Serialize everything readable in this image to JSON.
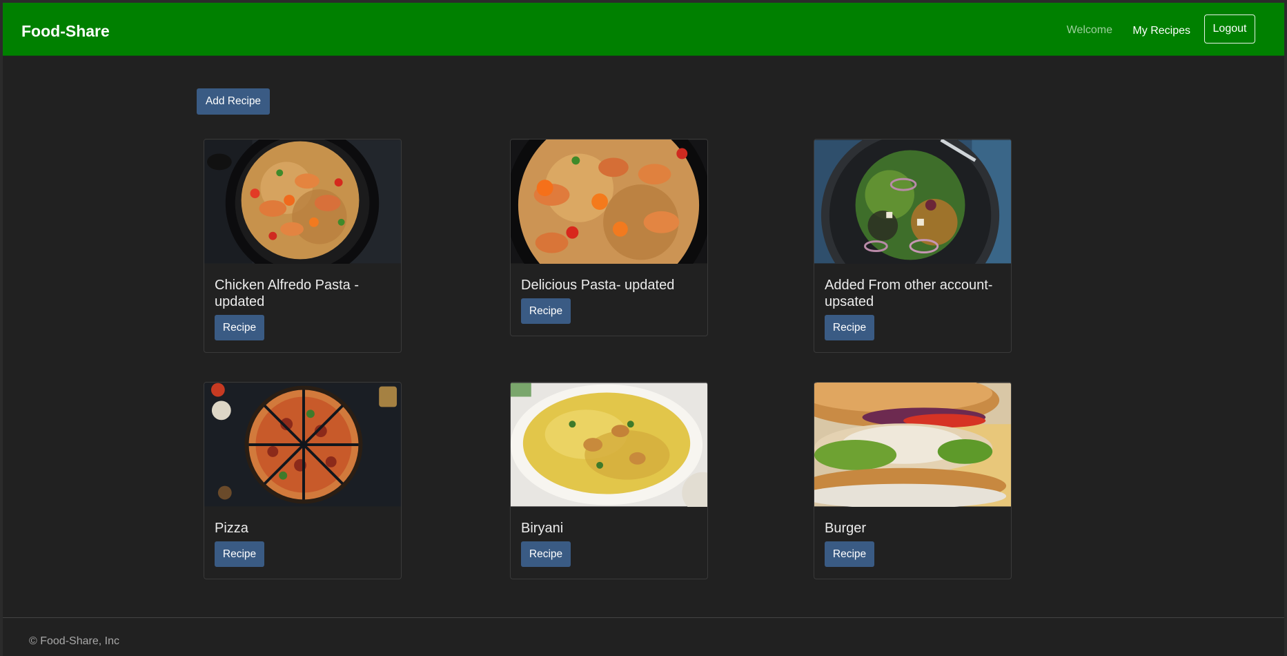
{
  "navbar": {
    "brand": "Food-Share",
    "welcome": "Welcome",
    "my_recipes": "My Recipes",
    "logout": "Logout"
  },
  "actions": {
    "add_recipe": "Add Recipe"
  },
  "cards": [
    {
      "title": "Chicken Alfredo Pasta - updated",
      "button": "Recipe"
    },
    {
      "title": "Delicious Pasta- updated",
      "button": "Recipe"
    },
    {
      "title": "Added From other account- upsated",
      "button": "Recipe"
    },
    {
      "title": "Pizza",
      "button": "Recipe"
    },
    {
      "title": "Biryani",
      "button": "Recipe"
    },
    {
      "title": "Burger",
      "button": "Recipe"
    }
  ],
  "footer": {
    "text": "© Food-Share, Inc"
  },
  "colors": {
    "navbar": "#008000",
    "background": "#212121",
    "button": "#3a5b84"
  }
}
